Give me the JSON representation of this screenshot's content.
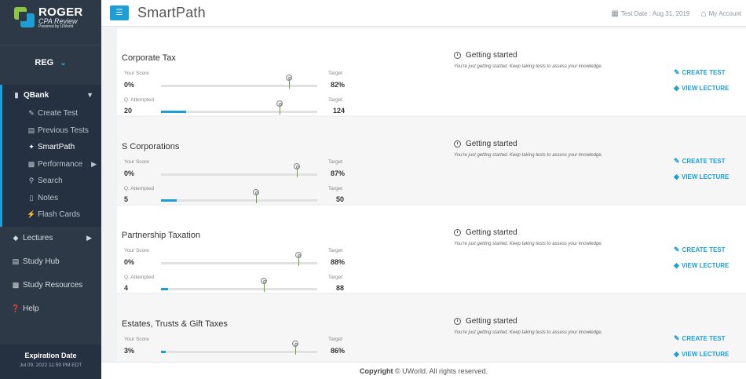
{
  "brand": {
    "name": "ROGER",
    "subtitle": "CPA Review",
    "powered": "Powered by UWorld"
  },
  "section_selector": {
    "value": "REG"
  },
  "nav": {
    "qbank": "QBank",
    "sub_items": {
      "create_test": "Create Test",
      "previous_tests": "Previous Tests",
      "smartpath": "SmartPath",
      "performance": "Performance",
      "search": "Search",
      "notes": "Notes",
      "flash_cards": "Flash Cards"
    },
    "lectures": "Lectures",
    "study_hub": "Study Hub",
    "study_resources": "Study Resources",
    "help": "Help"
  },
  "expiration": {
    "title": "Expiration Date",
    "date": "Jul 09, 2022 11:59 PM EDT"
  },
  "header": {
    "title": "SmartPath",
    "test_date": "Test Date : Aug 31, 2019",
    "account": "My Account"
  },
  "labels": {
    "your_score": "Your Score",
    "target": "Target",
    "q_attempted": "Q. Attempted",
    "status": "Getting started",
    "status_desc": "You're just getting started. Keep taking tests to assess your knowledge.",
    "create_test": "CREATE TEST",
    "view_lecture": "VIEW LECTURE"
  },
  "topics": [
    {
      "name": "Corporate Tax",
      "score": "0%",
      "score_fraction": 0.0,
      "target_score": "82%",
      "target_score_fraction": 0.82,
      "attempted": "20",
      "target_attempted": "124",
      "attempted_fraction": 0.161
    },
    {
      "name": "S Corporations",
      "score": "0%",
      "score_fraction": 0.0,
      "target_score": "87%",
      "target_score_fraction": 0.87,
      "attempted": "5",
      "target_attempted": "50",
      "attempted_fraction": 0.1
    },
    {
      "name": "Partnership Taxation",
      "score": "0%",
      "score_fraction": 0.0,
      "target_score": "88%",
      "target_score_fraction": 0.88,
      "attempted": "4",
      "target_attempted": "88",
      "attempted_fraction": 0.045
    },
    {
      "name": "Estates, Trusts & Gift Taxes",
      "score": "3%",
      "score_fraction": 0.03,
      "target_score": "86%",
      "target_score_fraction": 0.86
    }
  ],
  "footer": {
    "copyright_label": "Copyright",
    "copyright_text": "© UWorld. All rights reserved."
  },
  "colors": {
    "accent": "#1d9fd6",
    "sidebar": "#2d3946",
    "target_pin": "#6ba43a"
  }
}
